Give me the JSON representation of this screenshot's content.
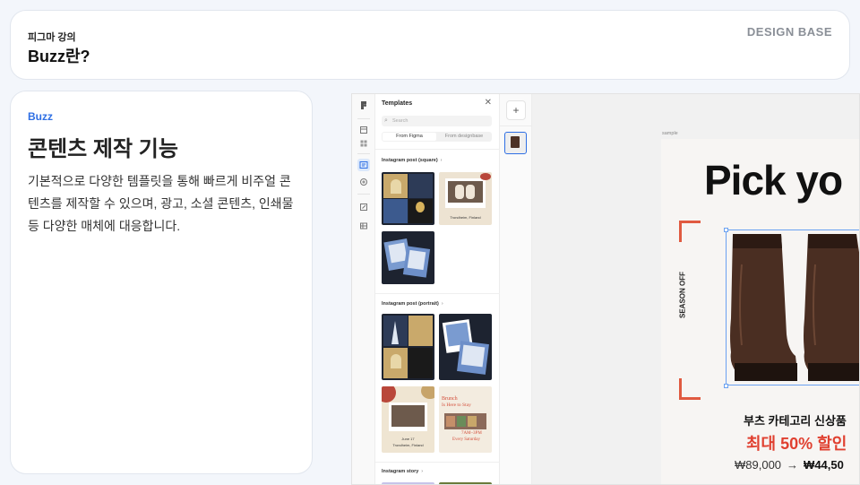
{
  "header": {
    "breadcrumb": "피그마 강의",
    "title": "Buzz란?",
    "logo": "DESIGN BASE"
  },
  "feature": {
    "label": "Buzz",
    "title": "콘텐츠 제작 기능",
    "description": "기본적으로 다양한 템플릿을 통해 빠르게 비주얼 콘텐츠를 제작할 수 있으며, 광고, 소셜 콘텐츠, 인쇄물 등 다양한 매체에 대응합니다."
  },
  "figma": {
    "toolbar_icons": [
      "figma-logo-icon",
      "frame-icon",
      "grid-icon",
      "templates-icon",
      "plus-circle-icon",
      "edit-icon",
      "table-icon"
    ],
    "templates_panel": {
      "title": "Templates",
      "search_placeholder": "Search",
      "tabs": [
        "From Figma",
        "From designbase"
      ],
      "categories": [
        "Instagram post (square)",
        "Instagram post (portrait)",
        "Instagram story"
      ],
      "thumb_captions": {
        "sq2": "Trondheim, Finland",
        "pt4_date": "June 17",
        "pt4_place": "Trondheim, Finland",
        "brunch_title": "Brunch",
        "brunch_sub": "Is Here to Stay",
        "brunch_time": "7AM–3PM",
        "brunch_day": "Every Saturday"
      }
    },
    "canvas": {
      "frame_label": "sample",
      "headline": "Pick yo",
      "side_text": "SEASON OFF",
      "promo_line": "부츠 카테고리 신상품",
      "promo_sale": "최대 50% 할인",
      "price_old": "₩89,000",
      "price_arrow": "→",
      "price_new": "₩44,50"
    }
  },
  "colors": {
    "accent": "#2f6fe4",
    "sale_red": "#e04030",
    "bracket": "#e05a40"
  }
}
